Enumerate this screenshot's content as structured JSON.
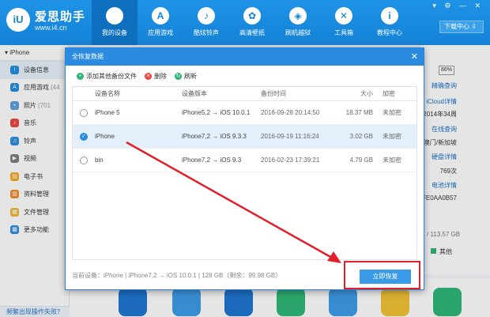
{
  "brand": {
    "logo_text": "iU",
    "name": "爱思助手",
    "url": "www.i4.cn"
  },
  "nav": [
    {
      "label": "我的设备",
      "icon": "apple-icon",
      "glyph": ""
    },
    {
      "label": "应用游戏",
      "icon": "app-store-icon",
      "glyph": "A"
    },
    {
      "label": "酷炫铃声",
      "icon": "bell-icon",
      "glyph": "♪"
    },
    {
      "label": "高清壁纸",
      "icon": "flower-icon",
      "glyph": "✿"
    },
    {
      "label": "刷机越狱",
      "icon": "box-icon",
      "glyph": "◈"
    },
    {
      "label": "工具箱",
      "icon": "tools-icon",
      "glyph": "✕"
    },
    {
      "label": "教程中心",
      "icon": "info-icon",
      "glyph": "i"
    }
  ],
  "window_controls": "▾ ⚙ — ✕",
  "download_center": "下载中心 ⇩",
  "sidebar": {
    "device": "▾ iPhone",
    "items": [
      {
        "label": "设备信息",
        "count": "",
        "color": "#1e8be0",
        "glyph": "i"
      },
      {
        "label": "应用游戏",
        "count": "(44",
        "color": "#1e8be0",
        "glyph": "A"
      },
      {
        "label": "照片",
        "count": "(701",
        "color": "#5a9de0",
        "glyph": "▪"
      },
      {
        "label": "音乐",
        "count": "",
        "color": "#e8453c",
        "glyph": "♪"
      },
      {
        "label": "铃声",
        "count": "",
        "color": "#2a8be0",
        "glyph": "♫"
      },
      {
        "label": "视频",
        "count": "",
        "color": "#7a7a7a",
        "glyph": "▶"
      },
      {
        "label": "电子书",
        "count": "",
        "color": "#f2a81d",
        "glyph": "▤"
      },
      {
        "label": "资料管理",
        "count": "",
        "color": "#f08a24",
        "glyph": "▥"
      },
      {
        "label": "文件管理",
        "count": "",
        "color": "#f2b632",
        "glyph": "▦"
      },
      {
        "label": "更多功能",
        "count": "",
        "color": "#2a8be0",
        "glyph": "▩"
      }
    ],
    "footer": "频繁出现操作失败？"
  },
  "right_col": {
    "battery": "86%",
    "rows": [
      {
        "text": "精确查询",
        "link": true
      },
      {
        "text": "iCloud详情",
        "link": true
      },
      {
        "text": "2014年34周",
        "link": false
      },
      {
        "text": "在线查询",
        "link": true
      },
      {
        "text": "澳门/新加坡",
        "link": false
      },
      {
        "text": "硬盘详情",
        "link": true
      },
      {
        "text": "769次",
        "link": false
      },
      {
        "text": "电池详情",
        "link": true
      },
      {
        "text": "FE0AA0B57",
        "link": false
      }
    ],
    "storage": "/ 113.57 GB",
    "legend_other": "其他"
  },
  "modal": {
    "title": "全恢复数据",
    "close": "✕",
    "toolbar": [
      {
        "label": "添加其他备份文件",
        "color": "#2bb673",
        "glyph": "+"
      },
      {
        "label": "删除",
        "color": "#e8453c",
        "glyph": "✕"
      },
      {
        "label": "刷新",
        "color": "#2bb673",
        "glyph": "↻"
      }
    ],
    "columns": [
      "设备名称",
      "设备版本",
      "备份时间",
      "大小",
      "加密"
    ],
    "rows": [
      {
        "name": "iPhone 5",
        "version": "iPhone5,2 → iOS 10.0.1",
        "time": "2016-09-28 20:14:50",
        "size": "18.37 MB",
        "enc": "未加密",
        "selected": false
      },
      {
        "name": "iPhone",
        "version": "iPhone7,2 → iOS 9.3.3",
        "time": "2016-09-19 11:16:24",
        "size": "3.02 GB",
        "enc": "未加密",
        "selected": true
      },
      {
        "name": "bin",
        "version": "iPhone7,2 → iOS 9.3",
        "time": "2016-02-23 17:39:21",
        "size": "4.79 GB",
        "enc": "未加密",
        "selected": false
      }
    ],
    "footer": "当前设备：iPhone  |  iPhone7,2 → iOS 10.0.1  |  128 GB（剩余：99.98 GB）",
    "restore_button": "立即恢复"
  },
  "colors": {
    "accent": "#1482d6",
    "highlight": "#e0202a",
    "green": "#2bb673"
  }
}
